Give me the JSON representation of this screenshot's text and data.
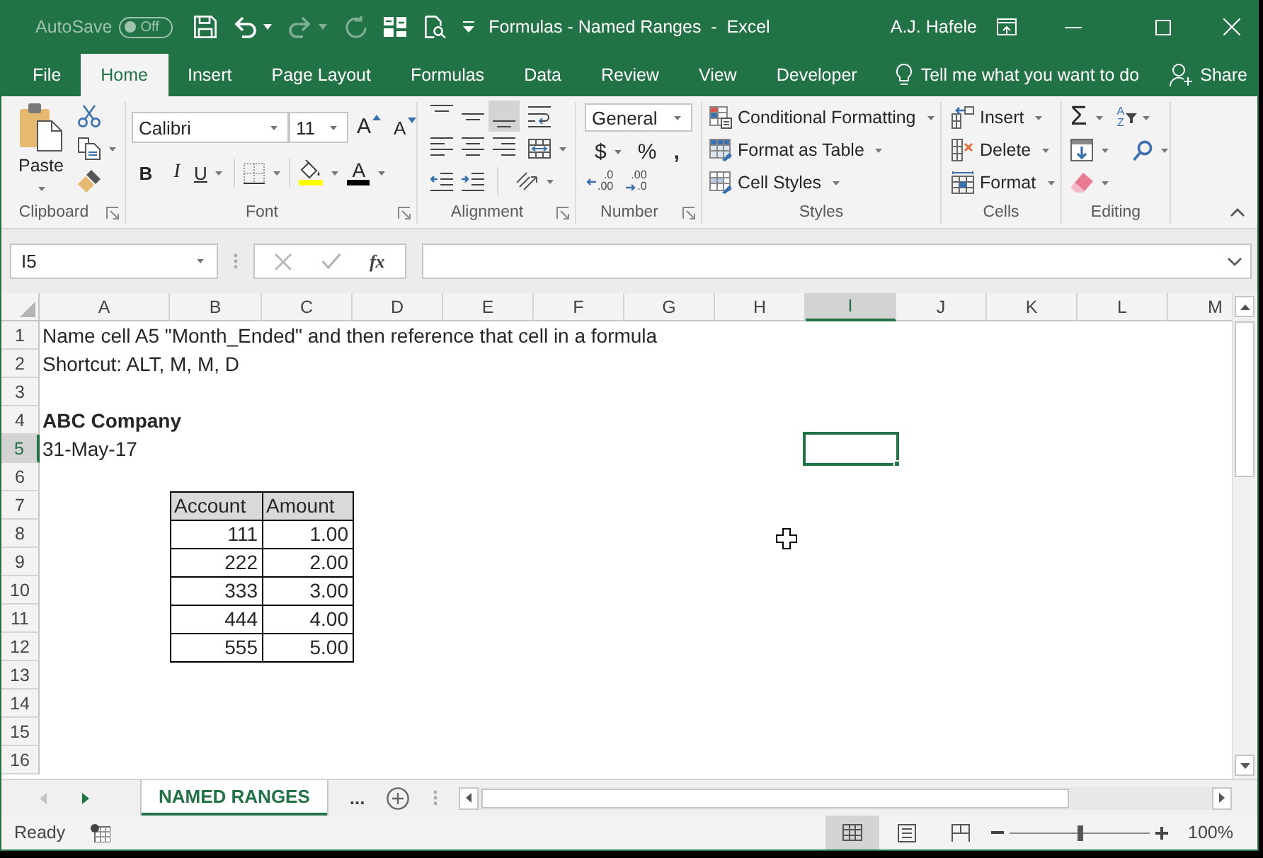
{
  "window": {
    "autosave": {
      "label": "AutoSave",
      "toggle": "Off",
      "on": false
    },
    "title": "Formulas - Named Ranges  -  Excel",
    "user": "A.J. Hafele"
  },
  "quick_access": [
    {
      "kind": "save",
      "disabled": false,
      "menu": false
    },
    {
      "kind": "undo",
      "disabled": false,
      "menu": true
    },
    {
      "kind": "redo",
      "disabled": true,
      "menu": true
    },
    {
      "kind": "touch",
      "disabled": true,
      "menu": false
    },
    {
      "kind": "form",
      "disabled": false,
      "menu": false
    },
    {
      "kind": "preview",
      "disabled": false,
      "menu": false
    }
  ],
  "tabs": [
    {
      "label": "File",
      "selected": false
    },
    {
      "label": "Home",
      "selected": true
    },
    {
      "label": "Insert",
      "selected": false
    },
    {
      "label": "Page Layout",
      "selected": false
    },
    {
      "label": "Formulas",
      "selected": false
    },
    {
      "label": "Data",
      "selected": false
    },
    {
      "label": "Review",
      "selected": false
    },
    {
      "label": "View",
      "selected": false
    },
    {
      "label": "Developer",
      "selected": false
    }
  ],
  "tell_me": {
    "placeholder": "Tell me what you want to do"
  },
  "share": "Share",
  "ribbon": {
    "clipboard": {
      "label": "Clipboard",
      "paste": "Paste"
    },
    "font": {
      "label": "Font",
      "font_name": "Calibri",
      "font_size": "11",
      "grow": "A",
      "shrink": "A",
      "bold": "B",
      "italic": "I",
      "underline": "U",
      "font_color": "A"
    },
    "alignment": {
      "label": "Alignment",
      "vertical": [
        {
          "kind": "top",
          "selected": false
        },
        {
          "kind": "middle",
          "selected": false
        },
        {
          "kind": "bottom",
          "selected": true
        }
      ],
      "horizontal": [
        {
          "kind": "left",
          "selected": false
        },
        {
          "kind": "center",
          "selected": false
        },
        {
          "kind": "right",
          "selected": false
        }
      ]
    },
    "number": {
      "label": "Number",
      "format": "General",
      "currency": "$",
      "percent": "%",
      "comma": ",",
      "increase_decimal": {
        "top": ".0",
        "bottom": ".00"
      },
      "decrease_decimal": {
        "top": ".00",
        "bottom": ".0"
      }
    },
    "styles": {
      "label": "Styles",
      "items": [
        {
          "kind": "conditional",
          "label": "Conditional Formatting"
        },
        {
          "kind": "table",
          "label": "Format as Table"
        },
        {
          "kind": "cell_styles",
          "label": "Cell Styles"
        }
      ]
    },
    "cells": {
      "label": "Cells",
      "items": [
        {
          "kind": "insert",
          "label": "Insert"
        },
        {
          "kind": "delete",
          "label": "Delete"
        },
        {
          "kind": "format",
          "label": "Format"
        }
      ]
    },
    "editing": {
      "label": "Editing",
      "sum": "Σ",
      "sort": {
        "top": "A",
        "bottom": "Z"
      }
    }
  },
  "formula_bar": {
    "name_box": "I5",
    "function": "fx"
  },
  "sheet": {
    "columns": [
      {
        "label": "A",
        "selected": false
      },
      {
        "label": "B",
        "selected": false
      },
      {
        "label": "C",
        "selected": false
      },
      {
        "label": "D",
        "selected": false
      },
      {
        "label": "E",
        "selected": false
      },
      {
        "label": "F",
        "selected": false
      },
      {
        "label": "G",
        "selected": false
      },
      {
        "label": "H",
        "selected": false
      },
      {
        "label": "I",
        "selected": true
      },
      {
        "label": "J",
        "selected": false
      },
      {
        "label": "K",
        "selected": false
      },
      {
        "label": "L",
        "selected": false
      },
      {
        "label": "M",
        "selected": false
      }
    ],
    "rows": [
      {
        "label": "1",
        "selected": false,
        "cells": [
          {
            "kind": "text",
            "text": "Name cell A5 \"Month_Ended\" and then reference that cell in a formula"
          }
        ]
      },
      {
        "label": "2",
        "selected": false,
        "cells": [
          {
            "kind": "text",
            "text": "Shortcut: ALT, M, M, D"
          }
        ]
      },
      {
        "label": "3",
        "selected": false
      },
      {
        "label": "4",
        "selected": false,
        "cells": [
          {
            "kind": "heading",
            "text": "ABC Company"
          }
        ]
      },
      {
        "label": "5",
        "selected": true,
        "cells": [
          {
            "kind": "text",
            "text": "31-May-17"
          }
        ]
      },
      {
        "label": "6",
        "selected": false
      },
      {
        "label": "7",
        "selected": false,
        "cells": [
          null,
          {
            "kind": "table_header",
            "text": "Account"
          },
          {
            "kind": "table_header",
            "text": "Amount"
          }
        ]
      },
      {
        "label": "8",
        "selected": false,
        "cells": [
          null,
          {
            "kind": "table_number",
            "text": "111"
          },
          {
            "kind": "table_number",
            "text": "1.00"
          }
        ]
      },
      {
        "label": "9",
        "selected": false,
        "cells": [
          null,
          {
            "kind": "table_number",
            "text": "222"
          },
          {
            "kind": "table_number",
            "text": "2.00"
          }
        ]
      },
      {
        "label": "10",
        "selected": false,
        "cells": [
          null,
          {
            "kind": "table_number",
            "text": "333"
          },
          {
            "kind": "table_number",
            "text": "3.00"
          }
        ]
      },
      {
        "label": "11",
        "selected": false,
        "cells": [
          null,
          {
            "kind": "table_number",
            "text": "444"
          },
          {
            "kind": "table_number",
            "text": "4.00"
          }
        ]
      },
      {
        "label": "12",
        "selected": false,
        "cells": [
          null,
          {
            "kind": "table_number",
            "text": "555"
          },
          {
            "kind": "table_number",
            "text": "5.00"
          }
        ]
      },
      {
        "label": "13",
        "selected": false
      },
      {
        "label": "14",
        "selected": false
      },
      {
        "label": "15",
        "selected": false
      },
      {
        "label": "16",
        "selected": false
      }
    ]
  },
  "sheet_tabs": [
    {
      "label": "NAMED RANGES",
      "selected": true
    }
  ],
  "more_sheets": "...",
  "status_bar": {
    "status": "Ready",
    "views": [
      {
        "kind": "normal",
        "selected": true
      },
      {
        "kind": "page_layout",
        "selected": false
      },
      {
        "kind": "page_break",
        "selected": false
      }
    ],
    "zoom": {
      "level": 0.5,
      "reading": "100%"
    }
  }
}
